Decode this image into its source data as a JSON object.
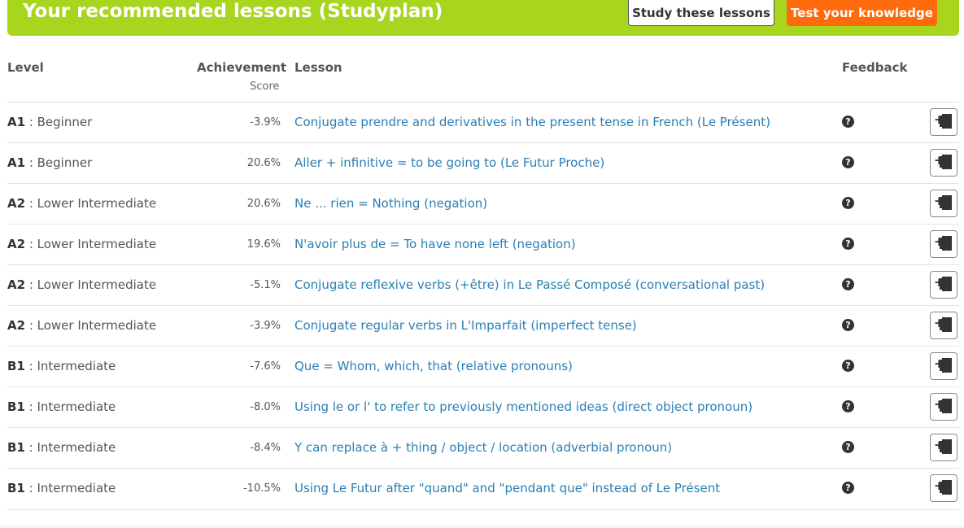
{
  "banner": {
    "title": "Your recommended lessons (Studyplan)",
    "study_button": "Study these lessons",
    "test_button": "Test your knowledge",
    "colors": {
      "banner": "#a8d61f",
      "test_button": "#ff6a0d",
      "link": "#2a7fb4"
    }
  },
  "table": {
    "headers": {
      "level": "Level",
      "achievement": "Achievement",
      "achievement_sub": "Score",
      "lesson": "Lesson",
      "feedback": "Feedback"
    },
    "rows": [
      {
        "level_code": "A1",
        "level_name": " : Beginner",
        "score": "-3.9%",
        "lesson": "Conjugate prendre and derivatives in the present tense in French (Le Présent)"
      },
      {
        "level_code": "A1",
        "level_name": " : Beginner",
        "score": "20.6%",
        "lesson": "Aller + infinitive = to be going to (Le Futur Proche)"
      },
      {
        "level_code": "A2",
        "level_name": " : Lower Intermediate",
        "score": "20.6%",
        "lesson": "Ne ... rien = Nothing (negation)"
      },
      {
        "level_code": "A2",
        "level_name": " : Lower Intermediate",
        "score": "19.6%",
        "lesson": "N'avoir plus de = To have none left (negation)"
      },
      {
        "level_code": "A2",
        "level_name": " : Lower Intermediate",
        "score": "-5.1%",
        "lesson": "Conjugate reflexive verbs (+être) in Le Passé Composé (conversational past)"
      },
      {
        "level_code": "A2",
        "level_name": " : Lower Intermediate",
        "score": "-3.9%",
        "lesson": "Conjugate regular verbs in L'Imparfait (imperfect tense)"
      },
      {
        "level_code": "B1",
        "level_name": " : Intermediate",
        "score": "-7.6%",
        "lesson": "Que = Whom, which, that (relative pronouns)"
      },
      {
        "level_code": "B1",
        "level_name": " : Intermediate",
        "score": "-8.0%",
        "lesson": "Using le or l' to refer to previously mentioned ideas (direct object pronoun)"
      },
      {
        "level_code": "B1",
        "level_name": " : Intermediate",
        "score": "-8.4%",
        "lesson": "Y can replace à + thing / object / location (adverbial pronoun)"
      },
      {
        "level_code": "B1",
        "level_name": " : Intermediate",
        "score": "-10.5%",
        "lesson": "Using Le Futur after \"quand\" and \"pendant que\" instead of Le Présent"
      }
    ],
    "icons": {
      "feedback": "question-circle-icon",
      "add": "add-to-studyplan-icon"
    }
  }
}
